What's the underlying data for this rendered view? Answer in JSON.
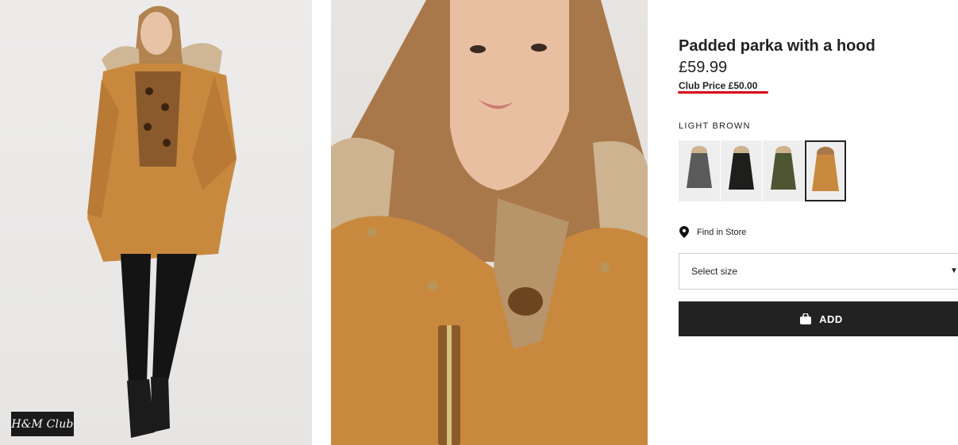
{
  "product": {
    "title": "Padded parka with a hood",
    "price": "£59.99",
    "club_price": "Club Price £50.00",
    "colors": {
      "selected_label": "LIGHT BROWN",
      "swatches": [
        {
          "name": "grey",
          "color": "#5a5a5a"
        },
        {
          "name": "black",
          "color": "#1e1f1c"
        },
        {
          "name": "khaki",
          "color": "#4e5532"
        },
        {
          "name": "light brown",
          "color": "#c8893f",
          "selected": true
        }
      ]
    }
  },
  "badge": {
    "label": "H&M Club"
  },
  "store": {
    "label": "Find in Store",
    "icon": "map-pin-icon"
  },
  "size_select": {
    "label": "Select size",
    "icon": "chevron-down-icon"
  },
  "add_button": {
    "label": "ADD",
    "icon": "shopping-bag-icon"
  },
  "theme": {
    "accent_underline": "#d4001a",
    "button_bg": "#222222",
    "parka_color": "#c8893f"
  }
}
